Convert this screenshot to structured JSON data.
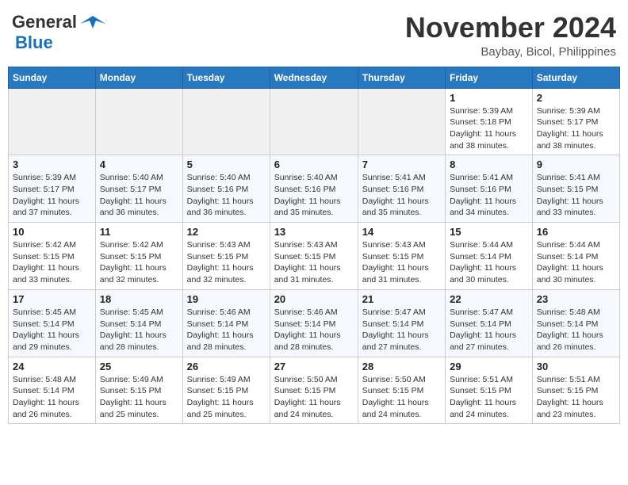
{
  "header": {
    "logo_line1": "General",
    "logo_line2": "Blue",
    "month": "November 2024",
    "location": "Baybay, Bicol, Philippines"
  },
  "weekdays": [
    "Sunday",
    "Monday",
    "Tuesday",
    "Wednesday",
    "Thursday",
    "Friday",
    "Saturday"
  ],
  "weeks": [
    [
      {
        "day": "",
        "info": ""
      },
      {
        "day": "",
        "info": ""
      },
      {
        "day": "",
        "info": ""
      },
      {
        "day": "",
        "info": ""
      },
      {
        "day": "",
        "info": ""
      },
      {
        "day": "1",
        "info": "Sunrise: 5:39 AM\nSunset: 5:18 PM\nDaylight: 11 hours\nand 38 minutes."
      },
      {
        "day": "2",
        "info": "Sunrise: 5:39 AM\nSunset: 5:17 PM\nDaylight: 11 hours\nand 38 minutes."
      }
    ],
    [
      {
        "day": "3",
        "info": "Sunrise: 5:39 AM\nSunset: 5:17 PM\nDaylight: 11 hours\nand 37 minutes."
      },
      {
        "day": "4",
        "info": "Sunrise: 5:40 AM\nSunset: 5:17 PM\nDaylight: 11 hours\nand 36 minutes."
      },
      {
        "day": "5",
        "info": "Sunrise: 5:40 AM\nSunset: 5:16 PM\nDaylight: 11 hours\nand 36 minutes."
      },
      {
        "day": "6",
        "info": "Sunrise: 5:40 AM\nSunset: 5:16 PM\nDaylight: 11 hours\nand 35 minutes."
      },
      {
        "day": "7",
        "info": "Sunrise: 5:41 AM\nSunset: 5:16 PM\nDaylight: 11 hours\nand 35 minutes."
      },
      {
        "day": "8",
        "info": "Sunrise: 5:41 AM\nSunset: 5:16 PM\nDaylight: 11 hours\nand 34 minutes."
      },
      {
        "day": "9",
        "info": "Sunrise: 5:41 AM\nSunset: 5:15 PM\nDaylight: 11 hours\nand 33 minutes."
      }
    ],
    [
      {
        "day": "10",
        "info": "Sunrise: 5:42 AM\nSunset: 5:15 PM\nDaylight: 11 hours\nand 33 minutes."
      },
      {
        "day": "11",
        "info": "Sunrise: 5:42 AM\nSunset: 5:15 PM\nDaylight: 11 hours\nand 32 minutes."
      },
      {
        "day": "12",
        "info": "Sunrise: 5:43 AM\nSunset: 5:15 PM\nDaylight: 11 hours\nand 32 minutes."
      },
      {
        "day": "13",
        "info": "Sunrise: 5:43 AM\nSunset: 5:15 PM\nDaylight: 11 hours\nand 31 minutes."
      },
      {
        "day": "14",
        "info": "Sunrise: 5:43 AM\nSunset: 5:15 PM\nDaylight: 11 hours\nand 31 minutes."
      },
      {
        "day": "15",
        "info": "Sunrise: 5:44 AM\nSunset: 5:14 PM\nDaylight: 11 hours\nand 30 minutes."
      },
      {
        "day": "16",
        "info": "Sunrise: 5:44 AM\nSunset: 5:14 PM\nDaylight: 11 hours\nand 30 minutes."
      }
    ],
    [
      {
        "day": "17",
        "info": "Sunrise: 5:45 AM\nSunset: 5:14 PM\nDaylight: 11 hours\nand 29 minutes."
      },
      {
        "day": "18",
        "info": "Sunrise: 5:45 AM\nSunset: 5:14 PM\nDaylight: 11 hours\nand 28 minutes."
      },
      {
        "day": "19",
        "info": "Sunrise: 5:46 AM\nSunset: 5:14 PM\nDaylight: 11 hours\nand 28 minutes."
      },
      {
        "day": "20",
        "info": "Sunrise: 5:46 AM\nSunset: 5:14 PM\nDaylight: 11 hours\nand 28 minutes."
      },
      {
        "day": "21",
        "info": "Sunrise: 5:47 AM\nSunset: 5:14 PM\nDaylight: 11 hours\nand 27 minutes."
      },
      {
        "day": "22",
        "info": "Sunrise: 5:47 AM\nSunset: 5:14 PM\nDaylight: 11 hours\nand 27 minutes."
      },
      {
        "day": "23",
        "info": "Sunrise: 5:48 AM\nSunset: 5:14 PM\nDaylight: 11 hours\nand 26 minutes."
      }
    ],
    [
      {
        "day": "24",
        "info": "Sunrise: 5:48 AM\nSunset: 5:14 PM\nDaylight: 11 hours\nand 26 minutes."
      },
      {
        "day": "25",
        "info": "Sunrise: 5:49 AM\nSunset: 5:15 PM\nDaylight: 11 hours\nand 25 minutes."
      },
      {
        "day": "26",
        "info": "Sunrise: 5:49 AM\nSunset: 5:15 PM\nDaylight: 11 hours\nand 25 minutes."
      },
      {
        "day": "27",
        "info": "Sunrise: 5:50 AM\nSunset: 5:15 PM\nDaylight: 11 hours\nand 24 minutes."
      },
      {
        "day": "28",
        "info": "Sunrise: 5:50 AM\nSunset: 5:15 PM\nDaylight: 11 hours\nand 24 minutes."
      },
      {
        "day": "29",
        "info": "Sunrise: 5:51 AM\nSunset: 5:15 PM\nDaylight: 11 hours\nand 24 minutes."
      },
      {
        "day": "30",
        "info": "Sunrise: 5:51 AM\nSunset: 5:15 PM\nDaylight: 11 hours\nand 23 minutes."
      }
    ]
  ]
}
